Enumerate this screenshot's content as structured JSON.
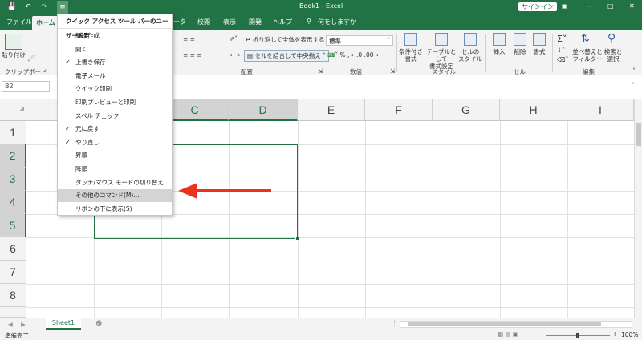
{
  "window": {
    "title": "Book1 - Excel",
    "search_hint": "何をしますか",
    "signin": "サインイン",
    "controls": [
      "—",
      "□",
      "✕"
    ]
  },
  "qat": {
    "save_icon": "save-icon",
    "undo_icon": "undo-icon",
    "redo_icon": "redo-icon",
    "customize_icon": "chevron-down-icon"
  },
  "tabs": [
    "ファイル",
    "ホーム",
    "ータ",
    "校閲",
    "表示",
    "開発",
    "ヘルプ"
  ],
  "ribbon": {
    "clipboard_label": "クリップボード",
    "paste_label": "貼り付け",
    "wrap_text": "折り返して全体を表示する",
    "merge_center": "セルを結合して中央揃え",
    "number_format": "標準",
    "alignment_group": "配置",
    "number_group": "数値",
    "styles": {
      "conditional": [
        "条件付き",
        "書式"
      ],
      "table": [
        "テーブルとして",
        "書式設定"
      ],
      "cell": [
        "セルの",
        "スタイル"
      ],
      "group": "スタイル"
    },
    "cells": {
      "insert": "挿入",
      "delete": "削除",
      "format": "書式",
      "group": "セル"
    },
    "editing": {
      "sort": [
        "並べ替えと",
        "フィルター"
      ],
      "find": [
        "検索と",
        "選択"
      ],
      "group": "編集"
    }
  },
  "namebox": "B2",
  "columns": [
    "C",
    "D",
    "E",
    "F",
    "G",
    "H",
    "I"
  ],
  "rows": [
    "1",
    "2",
    "3",
    "4",
    "5",
    "6",
    "7",
    "8"
  ],
  "menu": {
    "title": "クイック アクセス ツール バーのユーザー設定",
    "items": [
      {
        "label": "新規作成",
        "checked": false
      },
      {
        "label": "開く",
        "checked": false
      },
      {
        "label": "上書き保存",
        "checked": true
      },
      {
        "label": "電子メール",
        "checked": false
      },
      {
        "label": "クイック印刷",
        "checked": false
      },
      {
        "label": "印刷プレビューと印刷",
        "checked": false
      },
      {
        "label": "スペル チェック",
        "checked": false
      },
      {
        "label": "元に戻す",
        "checked": true
      },
      {
        "label": "やり直し",
        "checked": true
      },
      {
        "label": "昇順",
        "checked": false
      },
      {
        "label": "降順",
        "checked": false
      },
      {
        "label": "タッチ/マウス モードの切り替え",
        "checked": false
      },
      {
        "label": "その他のコマンド(M)...",
        "checked": false,
        "highlighted": true
      },
      {
        "label": "リボンの下に表示(S)",
        "checked": false
      }
    ]
  },
  "sheet_tab": "Sheet1",
  "status": {
    "ready": "準備完了",
    "zoom": "100%"
  },
  "colors": {
    "accent": "#217346",
    "arrow": "#e8341c"
  }
}
